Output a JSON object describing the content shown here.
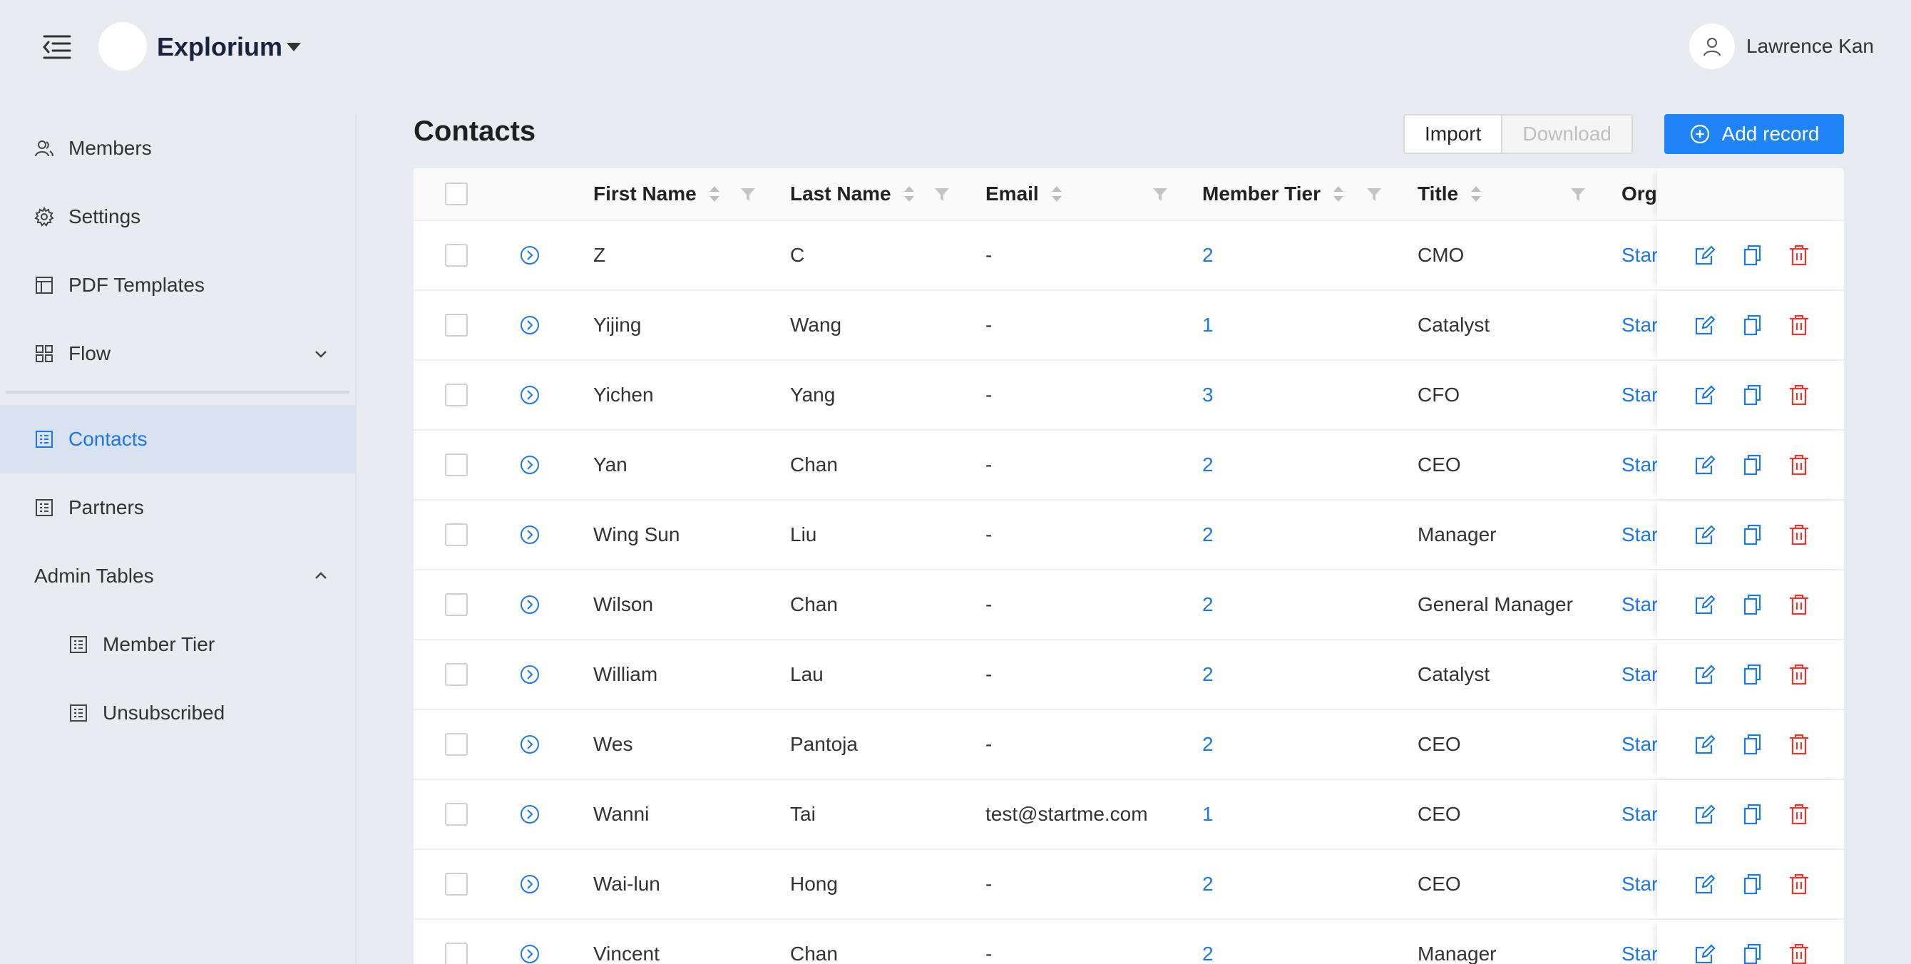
{
  "header": {
    "brand": "Explorium",
    "user_name": "Lawrence Kan"
  },
  "sidebar": {
    "items": [
      {
        "label": "Members",
        "icon": "users-icon"
      },
      {
        "label": "Settings",
        "icon": "gear-icon"
      },
      {
        "label": "PDF Templates",
        "icon": "layout-icon"
      },
      {
        "label": "Flow",
        "icon": "grid-icon"
      },
      {
        "label": "Contacts",
        "icon": "table-icon"
      },
      {
        "label": "Partners",
        "icon": "table-icon"
      },
      {
        "label": "Admin Tables",
        "icon": ""
      },
      {
        "label": "Member Tier",
        "icon": "table-icon"
      },
      {
        "label": "Unsubscribed",
        "icon": "table-icon"
      }
    ]
  },
  "page": {
    "title": "Contacts",
    "import_label": "Import",
    "download_label": "Download",
    "add_label": "Add record"
  },
  "table": {
    "columns": {
      "first_name": "First Name",
      "last_name": "Last Name",
      "email": "Email",
      "member_tier": "Member Tier",
      "title": "Title",
      "org": "Org"
    },
    "rows": [
      {
        "first": "Z",
        "last": "C",
        "email": "-",
        "tier": "2",
        "title": "CMO",
        "org": "Star"
      },
      {
        "first": "Yijing",
        "last": "Wang",
        "email": "-",
        "tier": "1",
        "title": "Catalyst",
        "org": "Star"
      },
      {
        "first": "Yichen",
        "last": "Yang",
        "email": "-",
        "tier": "3",
        "title": "CFO",
        "org": "Star"
      },
      {
        "first": "Yan",
        "last": "Chan",
        "email": "-",
        "tier": "2",
        "title": "CEO",
        "org": "Star"
      },
      {
        "first": "Wing Sun",
        "last": "Liu",
        "email": "-",
        "tier": "2",
        "title": "Manager",
        "org": "Star"
      },
      {
        "first": "Wilson",
        "last": "Chan",
        "email": "-",
        "tier": "2",
        "title": "General Manager",
        "org": "Star"
      },
      {
        "first": "William",
        "last": "Lau",
        "email": "-",
        "tier": "2",
        "title": "Catalyst",
        "org": "Star"
      },
      {
        "first": "Wes",
        "last": "Pantoja",
        "email": "-",
        "tier": "2",
        "title": "CEO",
        "org": "Star"
      },
      {
        "first": "Wanni",
        "last": "Tai",
        "email": "test@startme.com",
        "tier": "1",
        "title": "CEO",
        "org": "Star"
      },
      {
        "first": "Wai-lun",
        "last": "Hong",
        "email": "-",
        "tier": "2",
        "title": "CEO",
        "org": "Star"
      },
      {
        "first": "Vincent",
        "last": "Chan",
        "email": "-",
        "tier": "2",
        "title": "Manager",
        "org": "Star"
      }
    ]
  },
  "colors": {
    "accent": "#1f84f7",
    "link": "#1f78e0",
    "danger": "#e5392f",
    "background": "#e8ebf1"
  }
}
